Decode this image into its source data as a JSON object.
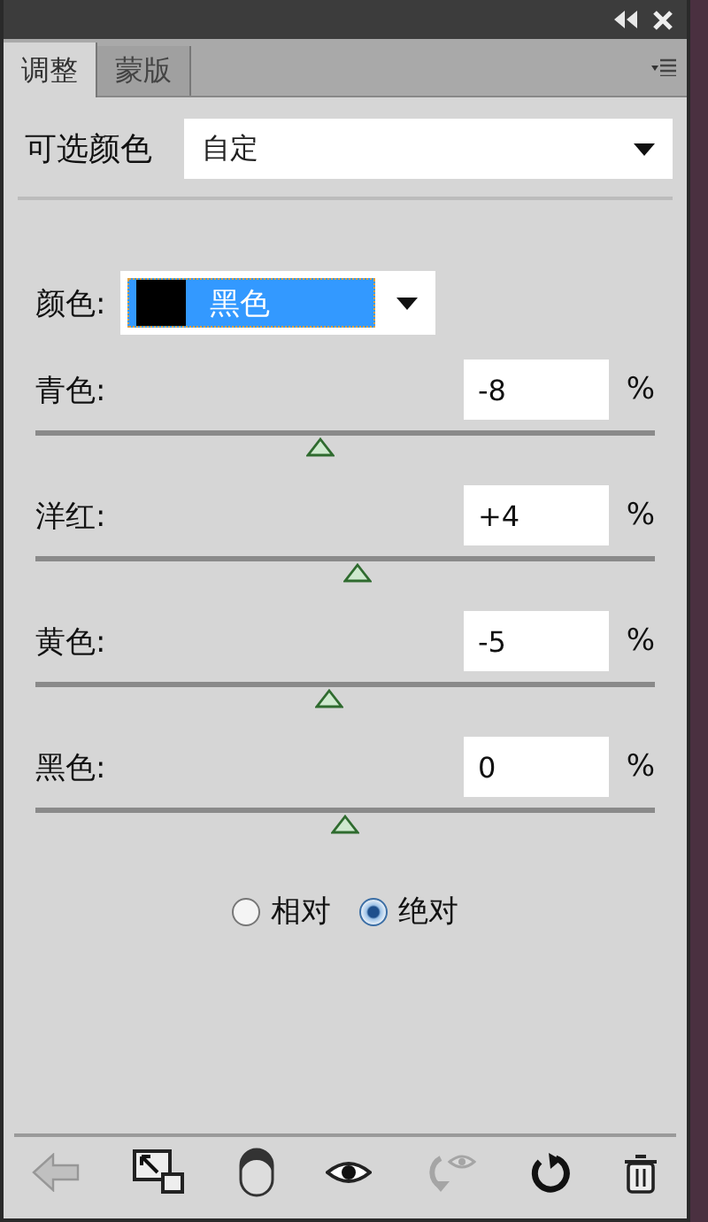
{
  "tabs": [
    {
      "label": "调整",
      "selected": true
    },
    {
      "label": "蒙版",
      "selected": false
    }
  ],
  "adjustment": {
    "title": "可选颜色",
    "preset": "自定"
  },
  "color": {
    "label": "颜色:",
    "value": "黑色"
  },
  "sliders": [
    {
      "label": "青色:",
      "value": "-8",
      "unit": "%",
      "level": 0.46
    },
    {
      "label": "洋红:",
      "value": "+4",
      "unit": "%",
      "level": 0.52
    },
    {
      "label": "黄色:",
      "value": "-5",
      "unit": "%",
      "level": 0.475
    },
    {
      "label": "黑色:",
      "value": "0",
      "unit": "%",
      "level": 0.5
    }
  ],
  "method": [
    {
      "label": "相对",
      "selected": false
    },
    {
      "label": "绝对",
      "selected": true
    }
  ],
  "toolbar": [
    {
      "kind": "back",
      "disabled": true
    },
    {
      "kind": "clip",
      "disabled": false
    },
    {
      "kind": "mask",
      "disabled": false
    },
    {
      "kind": "eye",
      "disabled": false
    },
    {
      "kind": "previous",
      "disabled": true
    },
    {
      "kind": "reset",
      "disabled": false
    },
    {
      "kind": "trash",
      "disabled": false
    }
  ]
}
